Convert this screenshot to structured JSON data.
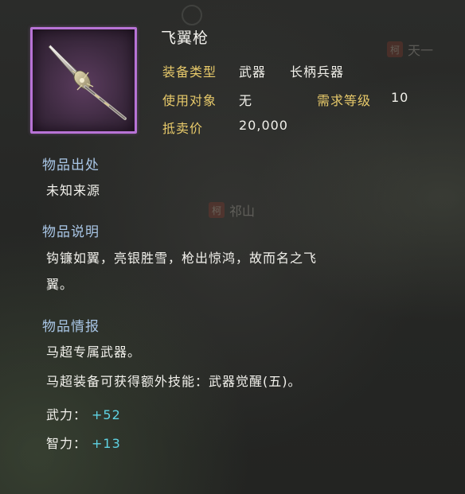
{
  "background_labels": [
    {
      "seal": "柯",
      "text": "天一"
    },
    {
      "seal": "柯",
      "text": "祁山"
    }
  ],
  "item": {
    "name": "飞翼枪",
    "icon": "spear-icon",
    "frame_color": "#b873d6"
  },
  "attributes": {
    "equip_type_label": "装备类型",
    "equip_type_value": "武器",
    "equip_subtype_value": "长柄兵器",
    "user_label": "使用对象",
    "user_value": "无",
    "level_label": "需求等级",
    "level_value": "10",
    "price_label": "抵卖价",
    "price_value": "20,000"
  },
  "origin": {
    "title": "物品出处",
    "text": "未知来源"
  },
  "description": {
    "title": "物品说明",
    "line1": "钩镰如翼，亮银胜雪，枪出惊鸿，故而名之飞",
    "line2": "翼。"
  },
  "info": {
    "title": "物品情报",
    "line1": "马超专属武器。",
    "line2": "马超装备可获得额外技能：武器觉醒(五)。"
  },
  "stats": [
    {
      "label": "武力：",
      "value": "+52"
    },
    {
      "label": "智力：",
      "value": "+13"
    }
  ],
  "colors": {
    "label_gold": "#e7c96a",
    "section_blue": "#a9c6e6",
    "stat_cyan": "#5fd3e3",
    "text_white": "#f2f1ec"
  }
}
